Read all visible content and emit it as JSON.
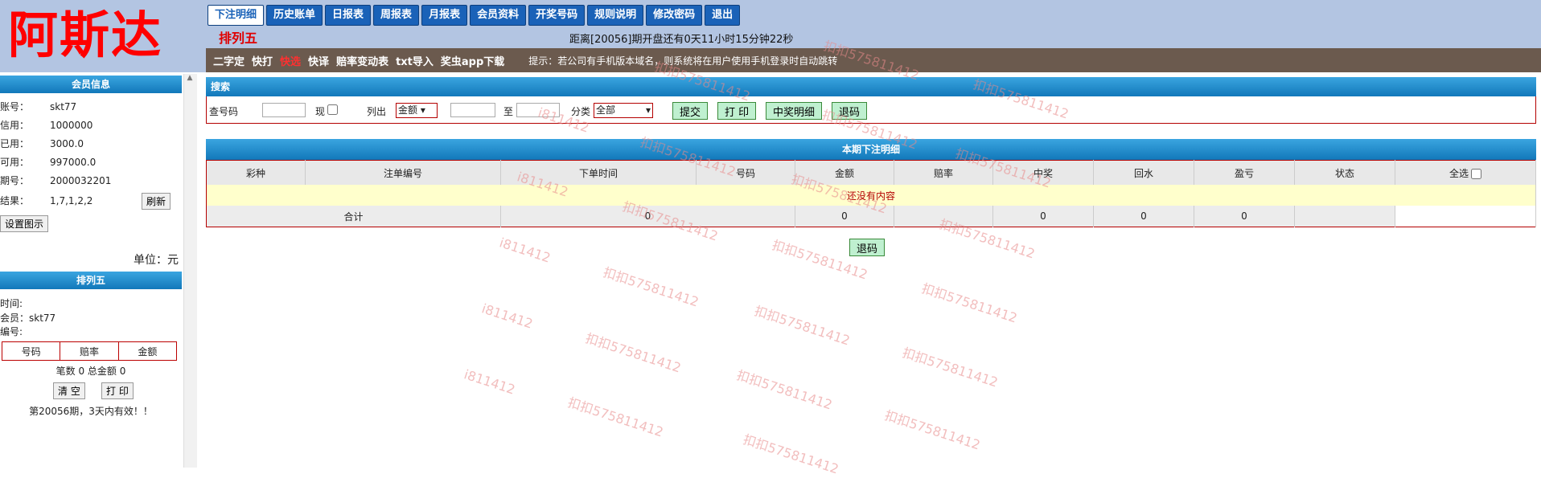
{
  "logo": "阿斯达",
  "nav": [
    "下注明细",
    "历史账单",
    "日报表",
    "周报表",
    "月报表",
    "会员资料",
    "开奖号码",
    "规则说明",
    "修改密码",
    "退出"
  ],
  "lottery_name": "排列五",
  "countdown": "距离[20056]期开盘还有0天11小时15分钟22秒",
  "subnav": [
    "二字定",
    "快打",
    "快选",
    "快译",
    "赔率变动表",
    "txt导入",
    "奖虫app下载"
  ],
  "subnav_red_index": 2,
  "tip": "提示：若公司有手机版本域名，则系统将在用户使用手机登录时自动跳转",
  "member": {
    "title": "会员信息",
    "rows": [
      {
        "label": "账号：",
        "value": "skt77"
      },
      {
        "label": "信用：",
        "value": "1000000"
      },
      {
        "label": "已用：",
        "value": "3000.0"
      },
      {
        "label": "可用：",
        "value": "997000.0"
      },
      {
        "label": "期号：",
        "value": "2000032201"
      },
      {
        "label": "结果：",
        "value": "1,7,1,2,2"
      }
    ],
    "refresh": "刷新",
    "setpic": "设置图示",
    "unit": "单位：元"
  },
  "pl5": {
    "title": "排列五",
    "time": "时间:",
    "member": "会员：skt77",
    "code": "编号:",
    "cols": [
      "号码",
      "赔率",
      "金额"
    ],
    "summary": "笔数 0 总金额 0",
    "clear": "清 空",
    "print": "打 印",
    "valid": "第20056期，3天内有效！！"
  },
  "search": {
    "title": "搜索",
    "query_label": "查号码",
    "now_label": "现",
    "list_label": "列出",
    "list_select": "金额",
    "to_label": "至",
    "category_label": "分类",
    "category_select": "全部",
    "submit": "提交",
    "print": "打 印",
    "winning": "中奖明细",
    "back": "退码"
  },
  "detail": {
    "title": "本期下注明细",
    "headers": [
      "彩种",
      "注单编号",
      "下单时间",
      "号码",
      "金额",
      "赔率",
      "中奖",
      "回水",
      "盈亏",
      "状态",
      "全选"
    ],
    "empty": "还没有内容",
    "sum_label": "合计",
    "sum_values": [
      "0",
      "0",
      "0",
      "0",
      "0"
    ]
  },
  "bottom_back": "退码",
  "watermark_a": "扣扣575811412",
  "watermark_b": "i811412"
}
